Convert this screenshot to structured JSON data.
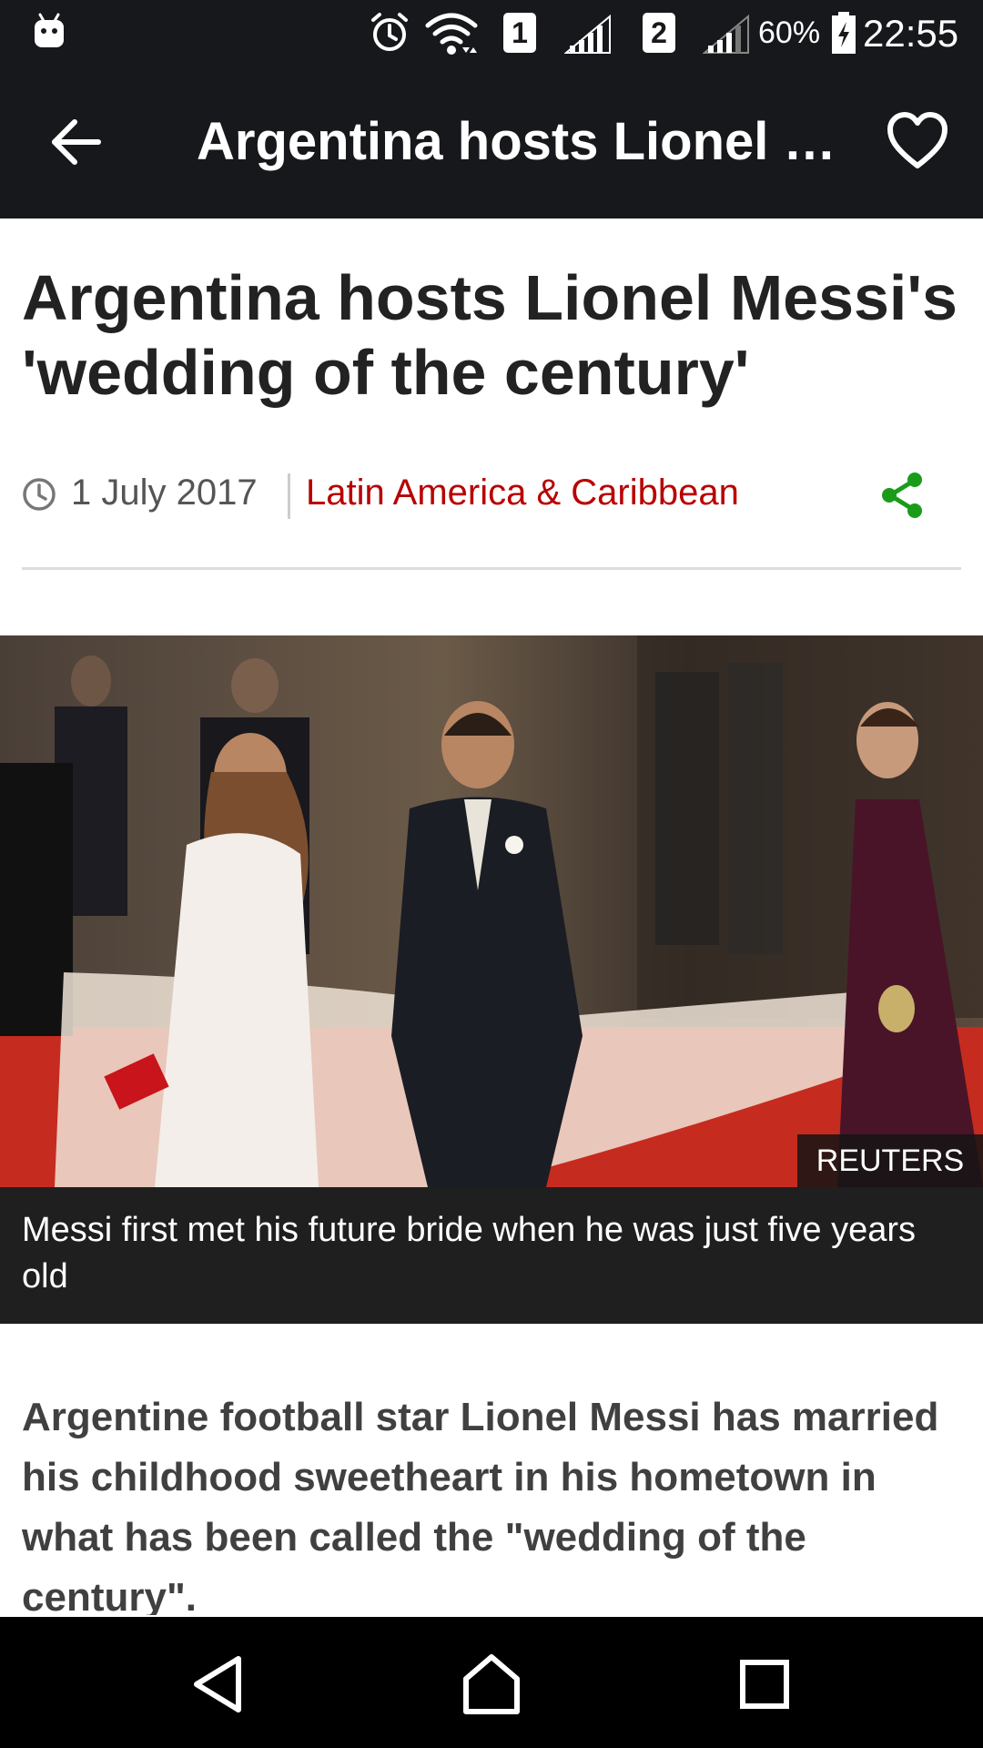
{
  "status_bar": {
    "sim1": "1",
    "sim2": "2",
    "battery": "60%",
    "time": "22:55",
    "icons": [
      "android-icon",
      "alarm-icon",
      "wifi-icon",
      "signal-icon",
      "battery-icon"
    ]
  },
  "toolbar": {
    "title": "Argentina hosts Lionel M...",
    "back_icon": "arrow-left-icon",
    "favorite_icon": "heart-outline-icon"
  },
  "article": {
    "headline": "Argentina hosts Lionel Messi's 'wedding of the century'",
    "date": "1 July 2017",
    "section": "Latin America & Caribbean",
    "image_credit": "REUTERS",
    "caption": "Messi first met his future bride when he was just five years old",
    "intro": "Argentine football star Lionel Messi has married his childhood sweetheart in his hometown in what has been called the \"wedding of the century\"."
  },
  "nav_bar": {
    "icons": [
      "nav-back-icon",
      "nav-home-icon",
      "nav-recents-icon"
    ]
  },
  "colors": {
    "bar_background": "#17181c",
    "section_link": "#b80000",
    "share_icon": "#1a9c1a",
    "caption_background": "#1f1f1f"
  }
}
